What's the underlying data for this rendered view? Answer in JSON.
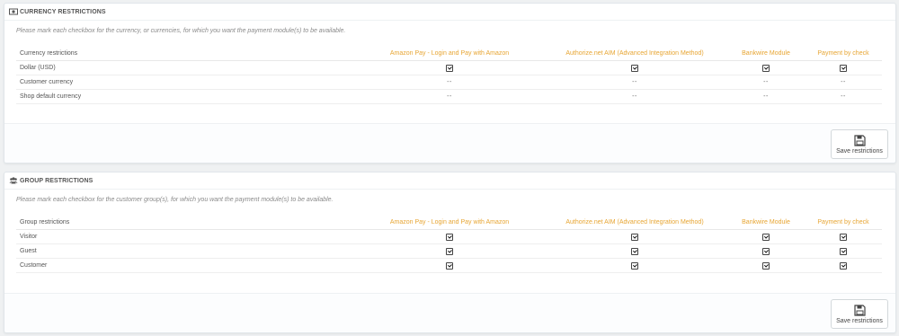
{
  "columns": [
    "Amazon Pay - Login and Pay with Amazon",
    "Authorize.net AIM (Advanced Integration Method)",
    "Bankwire Module",
    "Payment by check"
  ],
  "currency": {
    "title": "CURRENCY RESTRICTIONS",
    "help": "Please mark each checkbox for the currency, or currencies, for which you want the payment module(s) to be available.",
    "col_header": "Currency restrictions",
    "rows": [
      {
        "label": "Dollar (USD)",
        "cells": [
          "check",
          "check",
          "check",
          "check"
        ]
      },
      {
        "label": "Customer currency",
        "cells": [
          "--",
          "--",
          "--",
          "--"
        ]
      },
      {
        "label": "Shop default currency",
        "cells": [
          "--",
          "--",
          "--",
          "--"
        ]
      }
    ],
    "save_label": "Save restrictions"
  },
  "group": {
    "title": "GROUP RESTRICTIONS",
    "help": "Please mark each checkbox for the customer group(s), for which you want the payment module(s) to be available.",
    "col_header": "Group restrictions",
    "rows": [
      {
        "label": "Visitor",
        "cells": [
          "check",
          "check",
          "check",
          "check"
        ]
      },
      {
        "label": "Guest",
        "cells": [
          "check",
          "check",
          "check",
          "check"
        ]
      },
      {
        "label": "Customer",
        "cells": [
          "check",
          "check",
          "check",
          "check"
        ]
      }
    ],
    "save_label": "Save restrictions"
  },
  "icons": {
    "currency_heading": "money-icon",
    "group_heading": "group-icon",
    "save": "floppy-disk-icon"
  },
  "colors": {
    "module_header": "#e7a532",
    "text": "#555555",
    "page_bg": "#eff1f2"
  }
}
